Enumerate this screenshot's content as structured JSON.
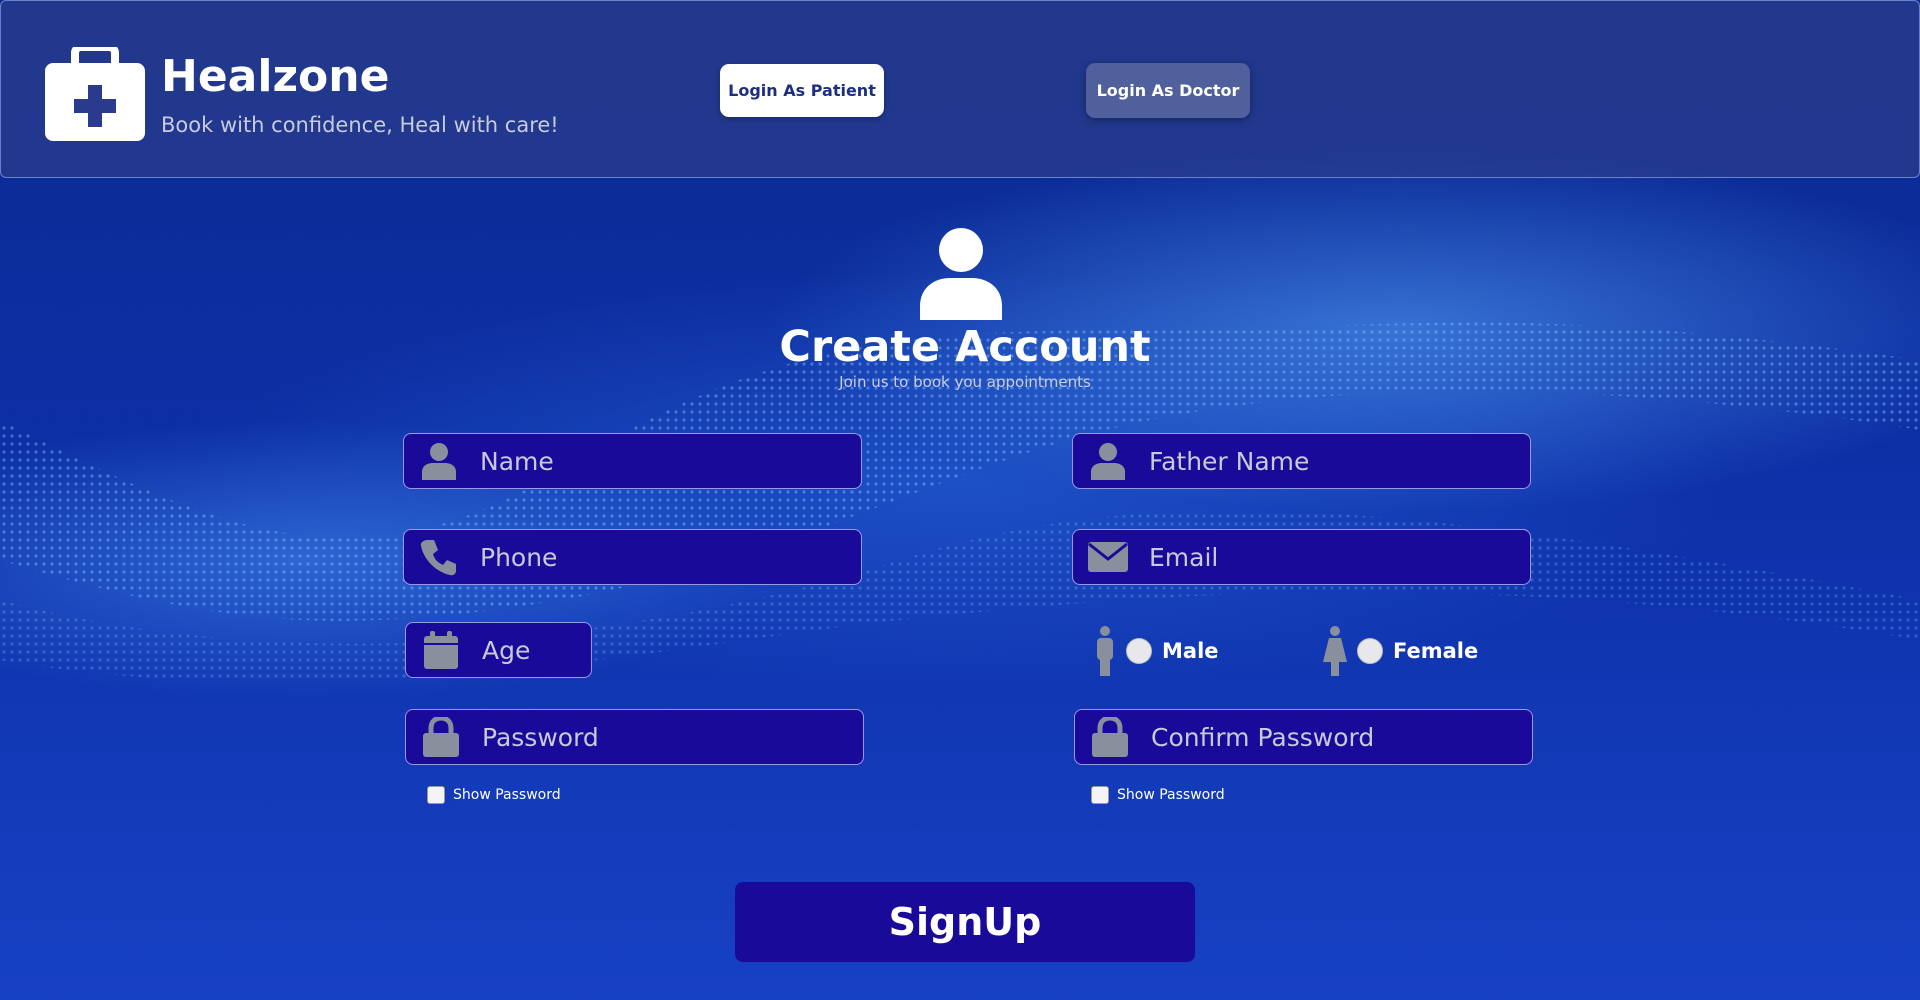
{
  "header": {
    "brand": "Healzone",
    "tagline": "Book with confidence, Heal with care!",
    "login_patient": "Login As Patient",
    "login_doctor": "Login As Doctor"
  },
  "main": {
    "title": "Create Account",
    "subtitle": "Join us to book you appointments"
  },
  "form": {
    "name_placeholder": "Name",
    "father_name_placeholder": "Father Name",
    "phone_placeholder": "Phone",
    "email_placeholder": "Email",
    "age_placeholder": "Age",
    "gender_male": "Male",
    "gender_female": "Female",
    "password_placeholder": "Password",
    "confirm_password_placeholder": "Confirm Password",
    "show_password_label": "Show Password",
    "signup_label": "SignUp"
  },
  "icons": {
    "logo": "medical-kit-icon",
    "avatar": "user-icon",
    "name": "user-icon",
    "father_name": "user-icon",
    "phone": "phone-icon",
    "email": "envelope-icon",
    "age": "calendar-icon",
    "password": "lock-icon",
    "male": "male-icon",
    "female": "female-icon"
  },
  "colors": {
    "field_bg": "#1a0a9a",
    "header_bg": "#28388c",
    "icon_gray": "#8a8f9e",
    "brand_text": "#1e2f80"
  }
}
